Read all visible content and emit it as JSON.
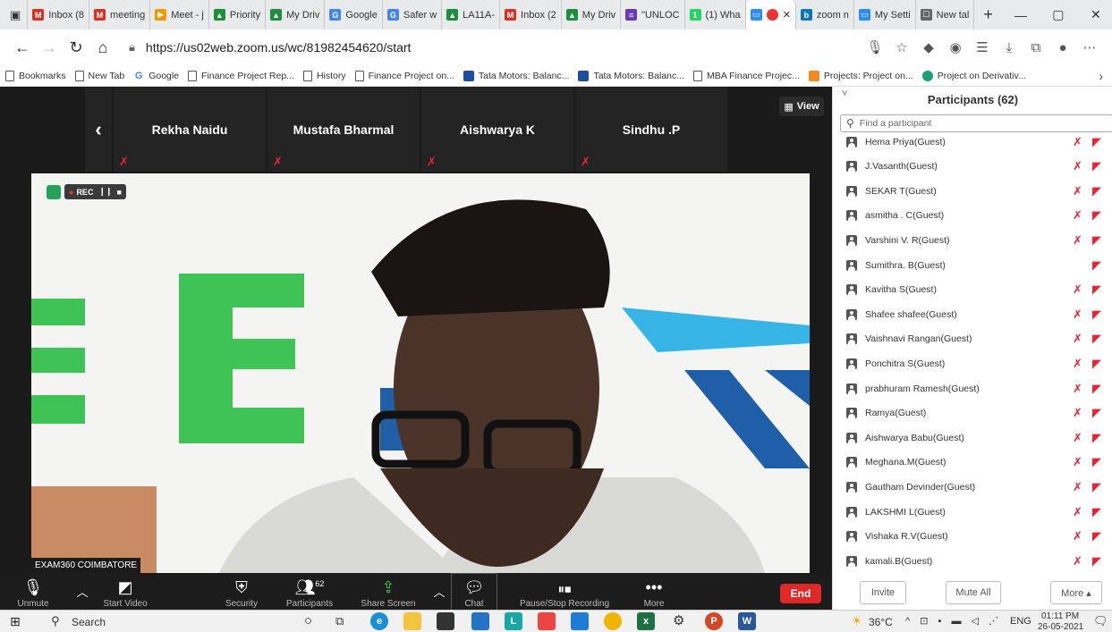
{
  "browser": {
    "tabs": [
      {
        "label": "Inbox (8",
        "icon": "gmail-icon",
        "color": "#d93025",
        "glyph": "M"
      },
      {
        "label": "meeting",
        "icon": "gmail-icon",
        "color": "#d93025",
        "glyph": "M"
      },
      {
        "label": "Meet - j",
        "icon": "meet-icon",
        "color": "#f29900",
        "glyph": "▶"
      },
      {
        "label": "Priority",
        "icon": "drive-icon",
        "color": "#1e8e3e",
        "glyph": "▲"
      },
      {
        "label": "My Driv",
        "icon": "drive-icon",
        "color": "#1e8e3e",
        "glyph": "▲"
      },
      {
        "label": "Google",
        "icon": "google-icon",
        "color": "#4285f4",
        "glyph": "G"
      },
      {
        "label": "Safer w",
        "icon": "google-icon",
        "color": "#4285f4",
        "glyph": "G"
      },
      {
        "label": "LA11A-",
        "icon": "drive-icon",
        "color": "#1e8e3e",
        "glyph": "▲"
      },
      {
        "label": "Inbox (2",
        "icon": "gmail-icon",
        "color": "#d93025",
        "glyph": "M"
      },
      {
        "label": "My Driv",
        "icon": "drive-icon",
        "color": "#1e8e3e",
        "glyph": "▲"
      },
      {
        "label": "\"UNLOC",
        "icon": "forms-icon",
        "color": "#673ab7",
        "glyph": "≡"
      },
      {
        "label": "(1) Wha",
        "icon": "whatsapp-icon",
        "color": "#25d366",
        "glyph": "1"
      },
      {
        "label": "",
        "icon": "zoom-icon",
        "color": "#2d8cff",
        "glyph": "▭",
        "active": true
      },
      {
        "label": "zoom n",
        "icon": "bing-icon",
        "color": "#0a77b5",
        "glyph": "b"
      },
      {
        "label": "My Setti",
        "icon": "zoom-icon",
        "color": "#2d8cff",
        "glyph": "▭"
      },
      {
        "label": "New tal",
        "icon": "newtab-icon",
        "color": "#666",
        "glyph": "☐"
      }
    ],
    "url": "https://us02web.zoom.us/wc/81982454620/start",
    "bookmarks": [
      {
        "label": "Bookmarks",
        "icon": "page-icon"
      },
      {
        "label": "New Tab",
        "icon": "page-icon"
      },
      {
        "label": "Google",
        "icon": "google-icon"
      },
      {
        "label": "Finance Project Rep...",
        "icon": "page-icon"
      },
      {
        "label": "History",
        "icon": "page-icon"
      },
      {
        "label": "Finance Project on...",
        "icon": "page-icon"
      },
      {
        "label": "Tata Motors: Balanc...",
        "icon": "tata-icon"
      },
      {
        "label": "Tata Motors: Balanc...",
        "icon": "tata-icon"
      },
      {
        "label": "MBA Finance Projec...",
        "icon": "page-icon"
      },
      {
        "label": "Projects: Project on...",
        "icon": "orange-icon"
      },
      {
        "label": "Project on Derivativ...",
        "icon": "green-icon"
      }
    ]
  },
  "meeting": {
    "thumbnails": [
      "Rekha Naidu",
      "Mustafa Bharmal",
      "Aishwarya K",
      "Sindhu .P"
    ],
    "view_label": "View",
    "rec_label": "REC",
    "speaker_name": "EXAM360 COIMBATORE"
  },
  "toolbar": {
    "unmute": "Unmute",
    "start_video": "Start Video",
    "security": "Security",
    "participants": "Participants",
    "participant_count": "62",
    "share_screen": "Share Screen",
    "chat": "Chat",
    "recording": "Pause/Stop Recording",
    "more": "More",
    "end": "End"
  },
  "panel": {
    "title": "Participants (62)",
    "search_placeholder": "Find a participant",
    "participants": [
      {
        "name": "Hema Priya(Guest)",
        "mic": true
      },
      {
        "name": "J.Vasanth(Guest)",
        "mic": true
      },
      {
        "name": "SEKAR T(Guest)",
        "mic": true
      },
      {
        "name": "asmitha . C(Guest)",
        "mic": true
      },
      {
        "name": "Varshini V. R(Guest)",
        "mic": true
      },
      {
        "name": "Sumithra. B(Guest)",
        "mic": false
      },
      {
        "name": "Kavitha S(Guest)",
        "mic": true
      },
      {
        "name": "Shafee shafee(Guest)",
        "mic": true
      },
      {
        "name": "Vaishnavi Rangan(Guest)",
        "mic": true
      },
      {
        "name": "Ponchitra S(Guest)",
        "mic": true
      },
      {
        "name": "prabhuram Ramesh(Guest)",
        "mic": true
      },
      {
        "name": "Ramya(Guest)",
        "mic": true
      },
      {
        "name": "Aishwarya Babu(Guest)",
        "mic": true
      },
      {
        "name": "Meghana.M(Guest)",
        "mic": true
      },
      {
        "name": "Gautham Devinder(Guest)",
        "mic": true
      },
      {
        "name": "LAKSHMI L(Guest)",
        "mic": true
      },
      {
        "name": "Vishaka R.V(Guest)",
        "mic": true
      },
      {
        "name": "kamali.B(Guest)",
        "mic": true
      }
    ],
    "invite": "Invite",
    "mute_all": "Mute All",
    "more": "More ▴"
  },
  "taskbar": {
    "search": "Search",
    "temperature": "36°C",
    "language": "ENG",
    "time": "01:11 PM",
    "date": "26-05-2021"
  }
}
